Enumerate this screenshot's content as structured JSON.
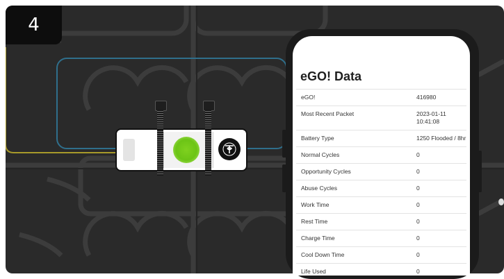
{
  "step": {
    "number": "4"
  },
  "screen": {
    "title": "eGO! Data",
    "rows": [
      {
        "label": "eGO!",
        "value": "416980"
      },
      {
        "label": "Most Recent Packet",
        "value": "2023-01-11 10:41:08"
      },
      {
        "label": "Battery Type",
        "value": "1250 Flooded / 8hr"
      },
      {
        "label": "Normal Cycles",
        "value": "0"
      },
      {
        "label": "Opportunity Cycles",
        "value": "0"
      },
      {
        "label": "Abuse Cycles",
        "value": "0"
      },
      {
        "label": "Work Time",
        "value": "0"
      },
      {
        "label": "Rest Time",
        "value": "0"
      },
      {
        "label": "Charge Time",
        "value": "0"
      },
      {
        "label": "Cool Down Time",
        "value": "0"
      },
      {
        "label": "Life Used",
        "value": "0"
      }
    ]
  },
  "device": {
    "led_color": "#6cc416",
    "logo_icon": "philadelphia-scientific-logo"
  },
  "colors": {
    "background": "#2a2a2a",
    "outline_blue": "#2f6f8c",
    "outline_yellow": "#a89a2a"
  }
}
